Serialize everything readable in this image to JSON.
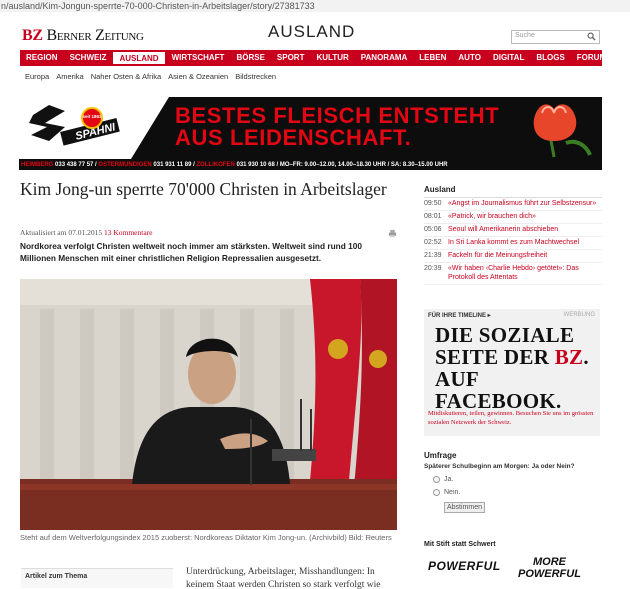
{
  "browser": {
    "url": "n/ausland/Kim-Jongun-sperrte-70-000-Christen-in-Arbeitslager/story/27381733"
  },
  "header": {
    "logo_bz": "BZ",
    "logo_name": "Berner Zeitung",
    "section": "AUSLAND",
    "search_placeholder": "Suche"
  },
  "nav": {
    "items": [
      "REGION",
      "SCHWEIZ",
      "AUSLAND",
      "WIRTSCHAFT",
      "BÖRSE",
      "SPORT",
      "KULTUR",
      "PANORAMA",
      "LEBEN",
      "AUTO",
      "DIGITAL",
      "BLOGS",
      "FORUM"
    ],
    "active": "AUSLAND",
    "sub": [
      "Europa",
      "Amerika",
      "Naher Osten & Afrika",
      "Asien & Ozeanien",
      "Bildstrecken"
    ]
  },
  "ad_banner": {
    "headline_1": "BESTES FLEISCH ENTSTEHT",
    "headline_2": "AUS LEIDENSCHAFT.",
    "badge_text": "seit 1863",
    "brand": "SPAHNI",
    "footer_red_1": "HEIMBERG",
    "footer_1": "033 438 77 57 /",
    "footer_red_2": "OSTERMUNDIGEN",
    "footer_2": "031 931 11 89 /",
    "footer_red_3": "ZOLLIKOFEN",
    "footer_3": "031 930 10 68 / MO–FR: 9.00–12.00, 14.00–18.30 UHR / SA: 8.30–15.00 UHR"
  },
  "article": {
    "title": "Kim Jong-un sperrte 70'000 Christen in Arbeitslager",
    "updated": "Aktualisiert am 07.01.2015",
    "comments": "13 Kommentare",
    "lead": "Nordkorea verfolgt Christen weltweit noch immer am stärksten. Weltweit sind rund 100 Millionen Menschen mit einer christlichen Religion Repressalien ausgesetzt.",
    "caption": "Steht auf dem Weltverfolgungsindex 2015 zuoberst: Nordkoreas Diktator Kim Jong-un. (Archivbild) Bild: Reuters",
    "related_label": "Artikel zum Thema",
    "body_start": "Unterdrückung, Arbeitslager, Misshandlungen: In keinem Staat werden Christen so stark verfolgt wie"
  },
  "sidebar": {
    "heading": "Ausland",
    "news": [
      {
        "time": "09:50",
        "headline": "«Angst im Journalismus führt zur Selbstzensur»"
      },
      {
        "time": "08:01",
        "headline": "«Patrick, wir brauchen dich»"
      },
      {
        "time": "05:06",
        "headline": "Seoul will Amerikanerin abschieben"
      },
      {
        "time": "02:52",
        "headline": "In Sri Lanka kommt es zum Machtwechsel"
      },
      {
        "time": "21:39",
        "headline": "Fackeln für die Meinungsfreiheit"
      },
      {
        "time": "20:39",
        "headline": "«Wir haben ‹Charlie Hebdo› getötet»: Das Protokoll des Attentats"
      }
    ],
    "fb_box": {
      "top_label": "FÜR IHRE TIMELINE ▸",
      "ad_label": "WERBUNG",
      "line1": "DIE SOZIALE",
      "line2a": "SEITE DER ",
      "line2b": "BZ",
      "line2c": ".",
      "line3": "AUF FACEBOOK.",
      "small": "Mitdiskutieren, teilen, gewinnen. Besuchen Sie uns im grössten sozialen Netzwerk der Schweiz."
    },
    "poll": {
      "heading": "Umfrage",
      "question": "Späterer Schulbeginn am Morgen: Ja oder Nein?",
      "options": [
        "Ja.",
        "Nein."
      ],
      "vote_label": "Abstimmen"
    },
    "pen": {
      "heading": "Mit Stift statt Schwert",
      "word1": "POWERFUL",
      "word2a": "MORE",
      "word2b": "POWERFUL"
    }
  },
  "colors": {
    "brand_red": "#c8001e",
    "ad_red": "#e30613"
  }
}
